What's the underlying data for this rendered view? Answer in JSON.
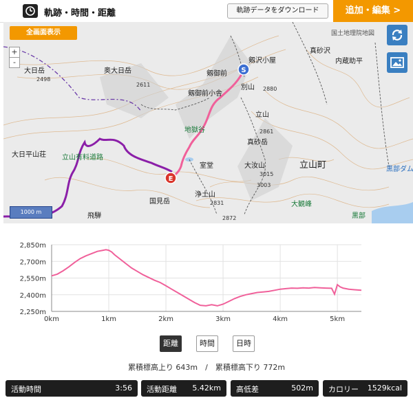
{
  "header": {
    "title": "軌跡・時間・距離",
    "download_label": "軌跡データをダウンロード",
    "add_edit_label": "追加・編集 >"
  },
  "map": {
    "fullscreen_label": "全画面表示",
    "attribution": "国土地理院地図",
    "zoom_in": "+",
    "zoom_out": "-",
    "scale_label": "1000 m",
    "start_marker": "S",
    "end_marker": "E",
    "labels": {
      "oohinode": "大日岳",
      "oku_oohinode": "奥大日岳",
      "tsurugisawa_hut": "剱沢小屋",
      "tsurugi_mae": "剱御前",
      "tsurugi_gozen_hut": "剱御前小舎",
      "bessan": "別山",
      "manago_sawa": "真砂沢",
      "uchikura": "内蔵助平",
      "tateyama": "立山",
      "manago_dake": "真砂岳",
      "ohnanji": "大汝山",
      "tateyama_town": "立山町",
      "kurobe_dam": "黒部ダム",
      "kurobe_top": "黒部",
      "jigokudani": "地獄谷",
      "murodo": "室堂",
      "jodo": "浄土山",
      "kunimi": "国見岳",
      "oohira_sanso": "大日平山荘",
      "tateyama_road": "立山有料道路",
      "hida": "飛騨",
      "daikanbou": "大観峰",
      "kurobe_bottom": "黒部",
      "elev_2498": "2498",
      "elev_2611": "2611",
      "elev_2880": "2880",
      "elev_2861": "2861",
      "elev_3015": "3015",
      "elev_3003": "3003",
      "elev_2831": "2831",
      "elev_2872": "2872"
    }
  },
  "chart_data": {
    "type": "line",
    "title": "",
    "xlabel": "",
    "ylabel": "",
    "x_ticks": [
      "0km",
      "1km",
      "2km",
      "3km",
      "4km",
      "5km"
    ],
    "y_ticks": [
      "2,250m",
      "2,400m",
      "2,550m",
      "2,700m",
      "2,850m"
    ],
    "xlim": [
      0,
      5.42
    ],
    "ylim": [
      2250,
      2850
    ],
    "series": [
      {
        "x": [
          0,
          0.1,
          0.2,
          0.3,
          0.4,
          0.5,
          0.6,
          0.7,
          0.8,
          0.9,
          0.95,
          1.0,
          1.05,
          1.1,
          1.2,
          1.3,
          1.4,
          1.5,
          1.6,
          1.7,
          1.8,
          1.9,
          2.0,
          2.1,
          2.2,
          2.3,
          2.4,
          2.5,
          2.6,
          2.7,
          2.8,
          2.9,
          3.0,
          3.1,
          3.2,
          3.3,
          3.4,
          3.5,
          3.6,
          3.7,
          3.8,
          3.9,
          4.0,
          4.1,
          4.2,
          4.3,
          4.4,
          4.5,
          4.6,
          4.7,
          4.8,
          4.9,
          4.95,
          5.0,
          5.05,
          5.1,
          5.2,
          5.3,
          5.42
        ],
        "y": [
          2570,
          2585,
          2615,
          2650,
          2690,
          2725,
          2750,
          2770,
          2790,
          2800,
          2805,
          2800,
          2785,
          2760,
          2720,
          2680,
          2640,
          2610,
          2580,
          2555,
          2530,
          2510,
          2480,
          2450,
          2420,
          2390,
          2360,
          2330,
          2305,
          2300,
          2310,
          2300,
          2315,
          2340,
          2365,
          2385,
          2400,
          2410,
          2420,
          2425,
          2430,
          2440,
          2450,
          2455,
          2460,
          2458,
          2462,
          2460,
          2465,
          2462,
          2460,
          2458,
          2405,
          2490,
          2470,
          2460,
          2450,
          2445,
          2440
        ]
      }
    ],
    "line_color": "#f0609a"
  },
  "controls": {
    "distance": "距離",
    "time": "時間",
    "datetime": "日時"
  },
  "summary": {
    "text": "累積標高上り 643m　/　累積標高下り 772m"
  },
  "stats": [
    {
      "label": "活動時間",
      "value": "3:56"
    },
    {
      "label": "活動距離",
      "value": "5.42km"
    },
    {
      "label": "高低差",
      "value": "502m"
    },
    {
      "label": "カロリー",
      "value": "1529kcal"
    }
  ]
}
